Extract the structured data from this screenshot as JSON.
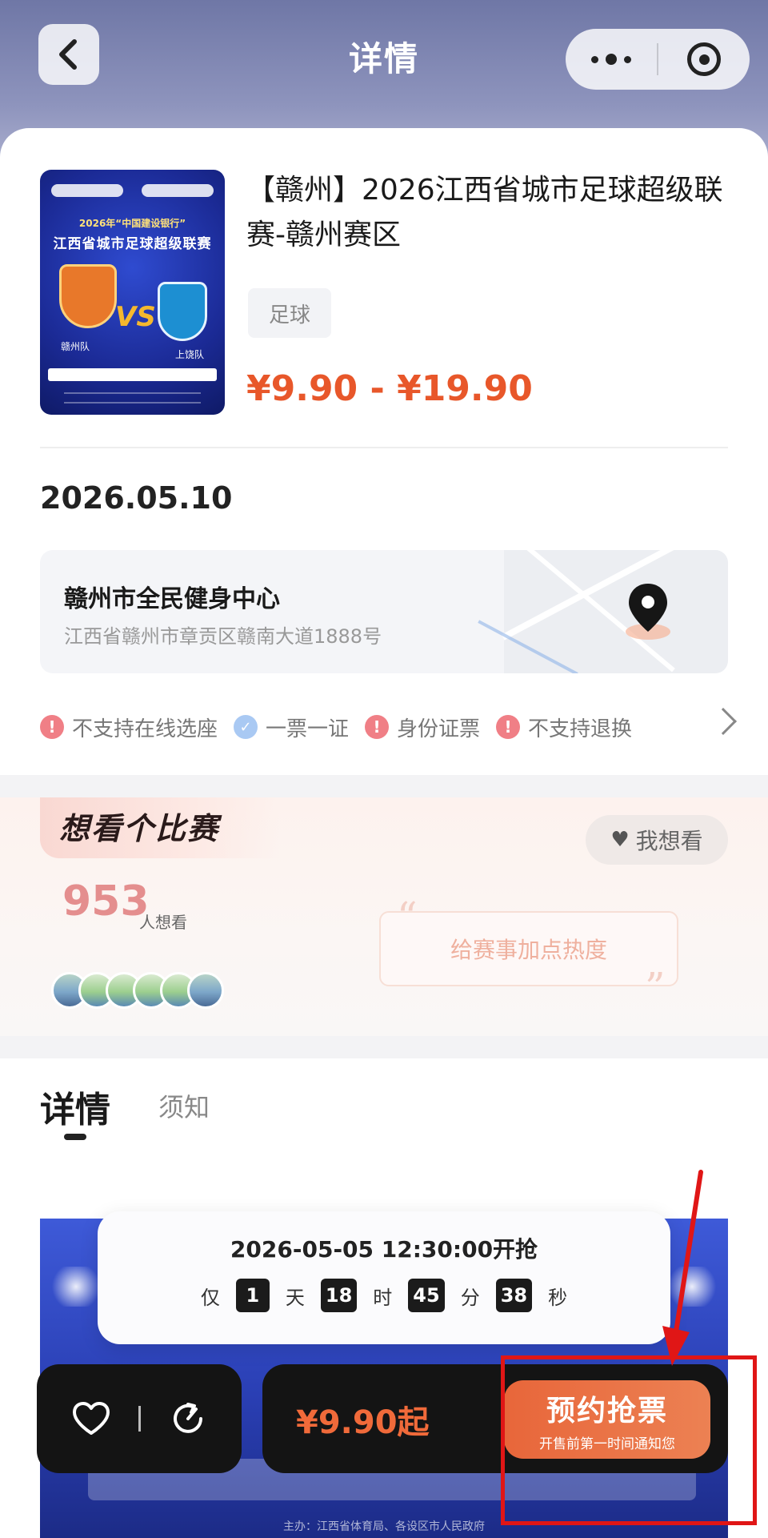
{
  "header": {
    "title": "详情"
  },
  "event": {
    "title": "【赣州】2026江西省城市足球超级联赛-赣州赛区",
    "tag": "足球",
    "price_range": "¥9.90 - ¥19.90",
    "date": "2026.05.10",
    "poster": {
      "subtitle": "2026年“中国建设银行”",
      "title": "江西省城市足球超级联赛",
      "vs": "VS",
      "team_left": "赣州队",
      "team_right": "上饶队"
    }
  },
  "venue": {
    "name": "赣州市全民健身中心",
    "address": "江西省赣州市章贡区赣南大道1888号"
  },
  "notices": [
    {
      "type": "warn",
      "text": "不支持在线选座"
    },
    {
      "type": "ok",
      "text": "一票一证"
    },
    {
      "type": "warn",
      "text": "身份证票"
    },
    {
      "type": "warn",
      "text": "不支持退换"
    }
  ],
  "want": {
    "title": "想看个比赛",
    "button": "我想看",
    "count": "953",
    "count_unit": "人想看",
    "heat_prompt": "给赛事加点热度"
  },
  "tabs": {
    "detail": "详情",
    "notice": "须知"
  },
  "countdown": {
    "title": "2026-05-05 12:30:00开抢",
    "prefix": "仅",
    "days": "1",
    "days_unit": "天",
    "hours": "18",
    "hours_unit": "时",
    "minutes": "45",
    "minutes_unit": "分",
    "seconds": "38",
    "seconds_unit": "秒"
  },
  "banner": {
    "bottom_text": "主办：江西省体育局、各设区市人民政府"
  },
  "bottom_bar": {
    "from_price": "¥9.90起",
    "book_main": "预约抢票",
    "book_sub": "开售前第一时间通知您"
  },
  "colors": {
    "accent": "#e8572a",
    "book_button": "#e8663a",
    "highlight": "#e01616"
  }
}
